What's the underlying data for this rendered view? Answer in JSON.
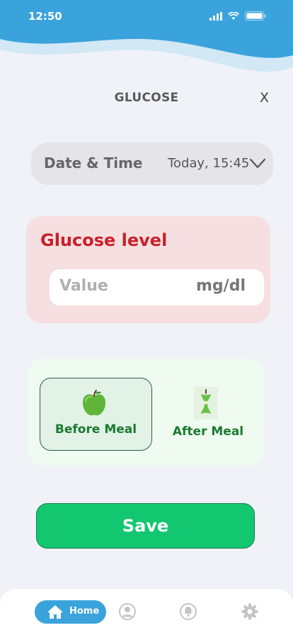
{
  "status_bar": {
    "time": "12:50"
  },
  "header": {
    "title": "GLUCOSE",
    "close_label": "X"
  },
  "datetime": {
    "label": "Date & Time",
    "value": "Today, 15:45"
  },
  "glucose": {
    "label": "Glucose level",
    "placeholder": "Value",
    "unit": "mg/dl"
  },
  "meal": {
    "before_label": "Before Meal",
    "after_label": "After Meal",
    "selected": "Before Meal"
  },
  "save_label": "Save",
  "nav": {
    "home_label": "Home",
    "items": [
      "home-icon",
      "profile-icon",
      "bell-icon",
      "gear-icon"
    ]
  },
  "colors": {
    "accent": "#3aa3dc",
    "glucose_red": "#c9202a",
    "save_green": "#12c770",
    "meal_green": "#1b7a2f"
  }
}
